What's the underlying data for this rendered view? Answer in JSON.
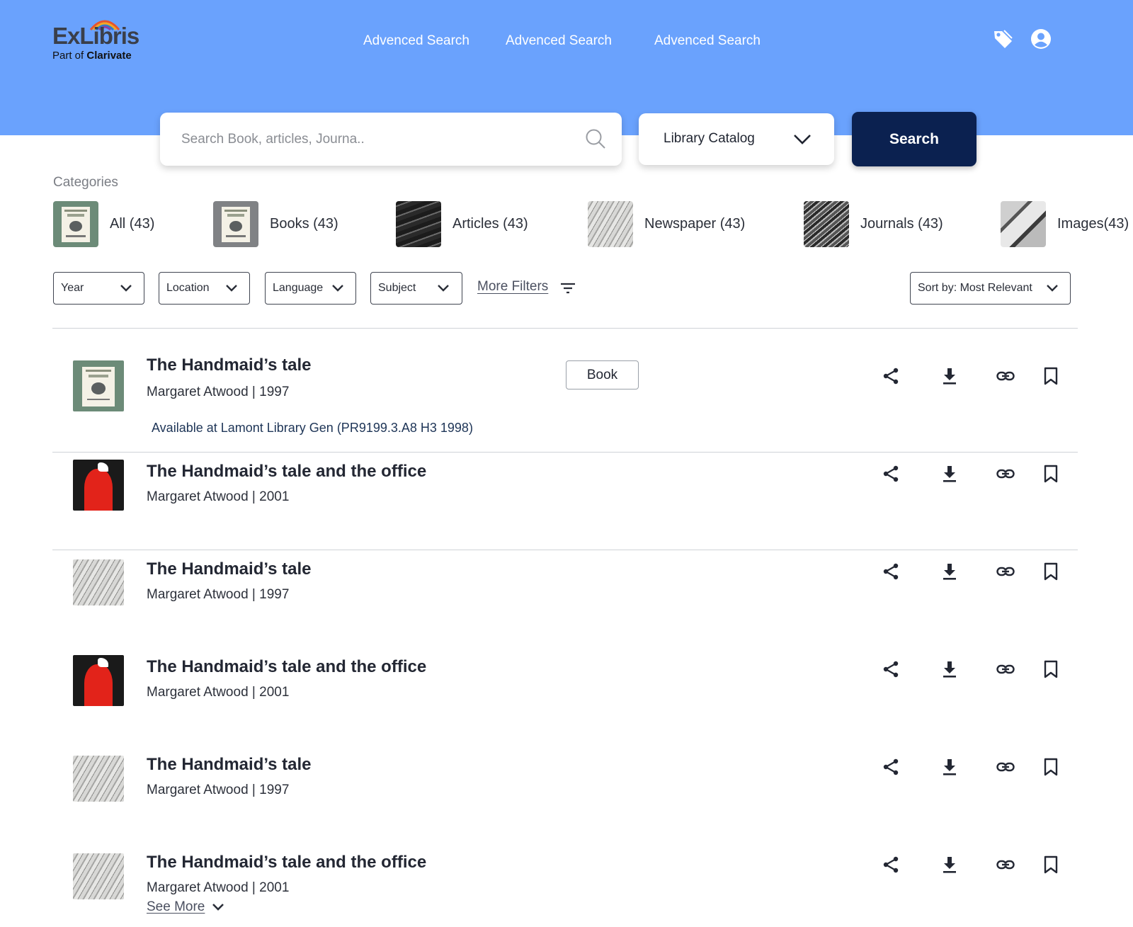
{
  "brand": {
    "name": "ExLibris",
    "tagline_prefix": "Part of",
    "tagline_brand": "Clarivate"
  },
  "nav": [
    {
      "label": "Advenced Search"
    },
    {
      "label": "Advenced Search"
    },
    {
      "label": "Advenced Search"
    }
  ],
  "header_icons": [
    "tag-icon",
    "user-account-icon"
  ],
  "search": {
    "placeholder": "Search Book, articles, Journa..",
    "value": "",
    "scope_label": "Library Catalog",
    "button_label": "Search"
  },
  "categories": {
    "heading": "Categories",
    "items": [
      {
        "label": "All (43)"
      },
      {
        "label": "Books (43)"
      },
      {
        "label": "Articles (43)"
      },
      {
        "label": "Newspaper (43)"
      },
      {
        "label": "Journals (43)"
      },
      {
        "label": "Images(43)"
      }
    ]
  },
  "filters": {
    "items": [
      {
        "label": "Year"
      },
      {
        "label": "Location"
      },
      {
        "label": "Language"
      },
      {
        "label": "Subject"
      }
    ],
    "more_label": "More Filters",
    "sort_label": "Sort by: Most Relevant"
  },
  "results": [
    {
      "title": "The Handmaid’s tale",
      "meta": "Margaret Atwood | 1997",
      "badge": "Book",
      "availability": "Available at Lamont Library Gen (PR9199.3.A8 H3 1998)"
    },
    {
      "title": "The Handmaid’s tale and the office",
      "meta": "Margaret Atwood | 2001"
    },
    {
      "title": "The Handmaid’s tale",
      "meta": "Margaret Atwood | 1997"
    },
    {
      "title": "The Handmaid’s tale and the office",
      "meta": "Margaret Atwood | 2001"
    },
    {
      "title": "The Handmaid’s tale",
      "meta": "Margaret Atwood | 1997"
    },
    {
      "title": "The Handmaid’s tale and the office",
      "meta": "Margaret Atwood | 2001"
    }
  ],
  "result_actions": [
    "share-icon",
    "download-icon",
    "link-icon",
    "bookmark-icon"
  ],
  "see_more_label": "See More",
  "colors": {
    "header_bg": "#6aa2fd",
    "search_button": "#0b2150",
    "text_primary": "#232733"
  }
}
